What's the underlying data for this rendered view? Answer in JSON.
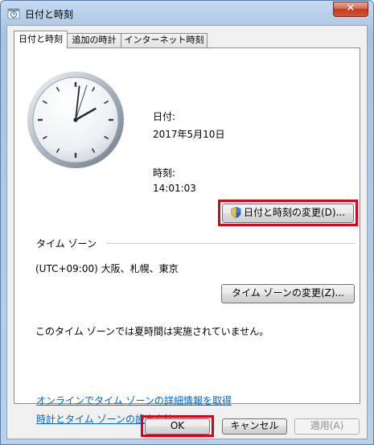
{
  "window": {
    "title": "日付と時刻"
  },
  "tabs": [
    {
      "label": "日付と時刻"
    },
    {
      "label": "追加の時計"
    },
    {
      "label": "インターネット時刻"
    }
  ],
  "date_section": {
    "date_label": "日付:",
    "date_value": "2017年5月10日",
    "time_label": "時刻:",
    "time_value": "14:01:03",
    "change_button": "日付と時刻の変更(D)..."
  },
  "timezone_section": {
    "heading": "タイム ゾーン",
    "current": "(UTC+09:00) 大阪、札幌、東京",
    "change_button": "タイム ゾーンの変更(Z)...",
    "dst_note": "このタイム ゾーンでは夏時間は実施されていません。"
  },
  "links": [
    {
      "label": "オンラインでタイム ゾーンの詳細情報を取得"
    },
    {
      "label": "時計とタイム ゾーンの設定方法"
    }
  ],
  "footer": {
    "ok": "OK",
    "cancel": "キャンセル",
    "apply": "適用(A)"
  },
  "clock_hands": {
    "hour": 14,
    "minute": 1,
    "second": 3
  },
  "colors": {
    "highlight": "#d9001b",
    "link": "#0066cc"
  },
  "icons": [
    "app-icon",
    "close-icon",
    "uac-shield-icon"
  ]
}
